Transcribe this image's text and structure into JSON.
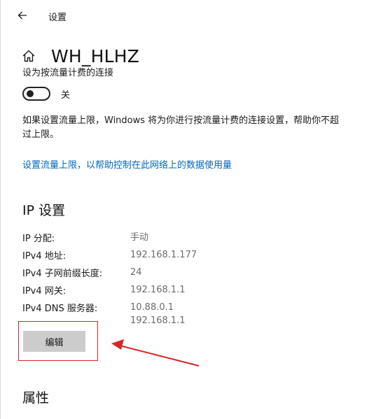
{
  "window": {
    "app_title": "设置"
  },
  "header": {
    "network_name": "WH_HLHZ"
  },
  "metered": {
    "clipped_label": "设为按流量计费的连接",
    "toggle_state_label": "关",
    "toggle_on": false,
    "description": "如果设置流量上限，Windows 将为你进行按流量计费的连接设置，帮助你不超过上限。",
    "link_text": "设置流量上限，以帮助控制在此网络上的数据使用量"
  },
  "ip_settings": {
    "title": "IP 设置",
    "rows": [
      {
        "label": "IP 分配:",
        "value": "手动"
      },
      {
        "label": "IPv4 地址:",
        "value": "192.168.1.177"
      },
      {
        "label": "IPv4 子网前缀长度:",
        "value": "24"
      },
      {
        "label": "IPv4 网关:",
        "value": "192.168.1.1"
      },
      {
        "label": "IPv4 DNS 服务器:",
        "value": "10.88.0.1",
        "value2": "192.168.1.1"
      }
    ],
    "edit_button": "编辑"
  },
  "properties": {
    "title": "属性"
  },
  "colors": {
    "accent": "#0067c0",
    "annotation": "#d62728",
    "button_bg": "#cccccc"
  },
  "icons": {
    "back": "back-arrow-icon",
    "home": "home-icon"
  }
}
